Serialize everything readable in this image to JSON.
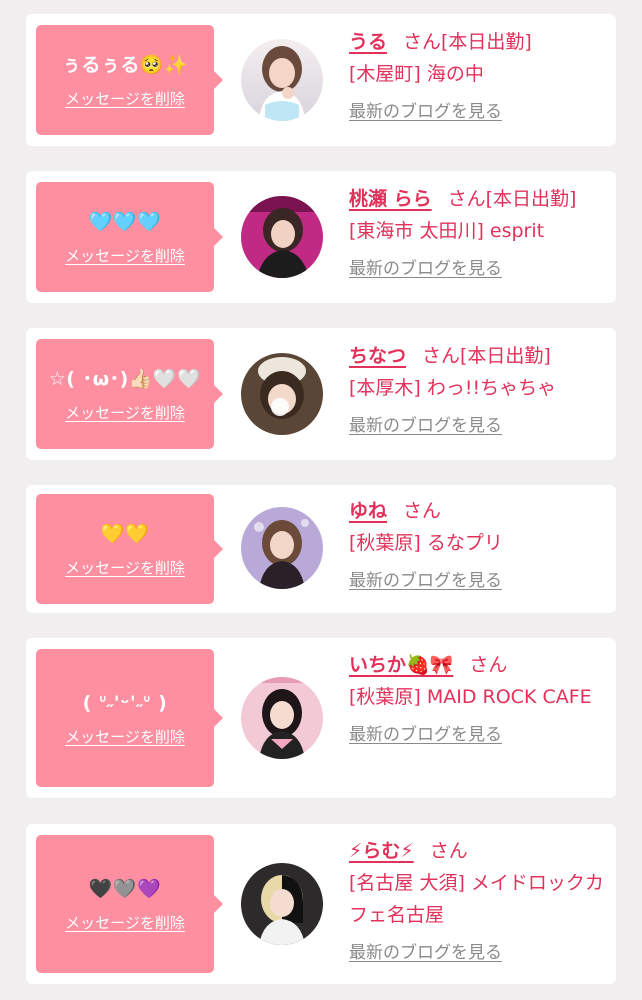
{
  "delete_label": "メッセージを削除",
  "blog_label": "最新のブログを見る",
  "colors": {
    "bubble": "#fd8fa0",
    "name": "#e2315a",
    "blog_link": "#8a8a8a",
    "background": "#f2eff0"
  },
  "entries": [
    {
      "message": "ぅるぅる🥺✨",
      "name": "うる",
      "suffix": "さん[本日出勤]",
      "location": "[木屋町] 海の中"
    },
    {
      "message": "🩵🩵🩵",
      "name": "桃瀬 らら",
      "suffix": "さん[本日出勤]",
      "location": "[東海市 太田川] esprit"
    },
    {
      "message": "☆( ･ω･)👍🏻🤍🤍",
      "name": "ちなつ",
      "suffix": "さん[本日出勤]",
      "location": "[本厚木] わっ!!ちゃちゃ"
    },
    {
      "message": "💛💛",
      "name": "ゆね",
      "suffix": "さん",
      "location": "[秋葉原] るなプリ"
    },
    {
      "message": "( ᐡ˶'ᵕ'˶ᐡ )",
      "name": "いちか🍓🎀",
      "suffix": "さん",
      "location": "[秋葉原] MAID ROCK CAFE"
    },
    {
      "message": "🖤🩶💜",
      "name": "⚡らむ⚡",
      "suffix": "さん",
      "location": "[名古屋 大須] メイドロックカフェ名古屋"
    }
  ]
}
